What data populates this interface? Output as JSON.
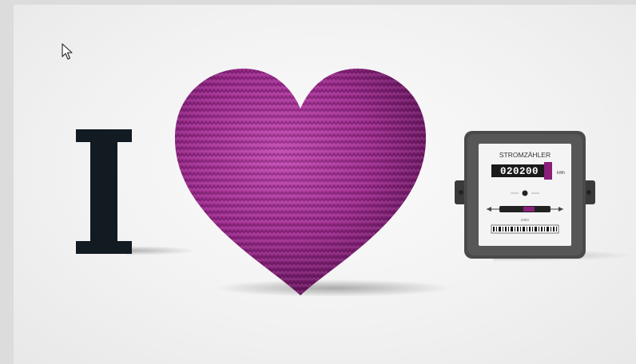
{
  "image": {
    "letter": "I",
    "heart_color": "#9b2c8c",
    "meter": {
      "label": "STROMZÄHLER",
      "reading": "020200",
      "unit": "kWh",
      "voltage": "230V",
      "case_color": "#4a4a4a",
      "accent_color": "#8a1f7a"
    },
    "cursor_icon": "pointer-arrow-icon"
  }
}
